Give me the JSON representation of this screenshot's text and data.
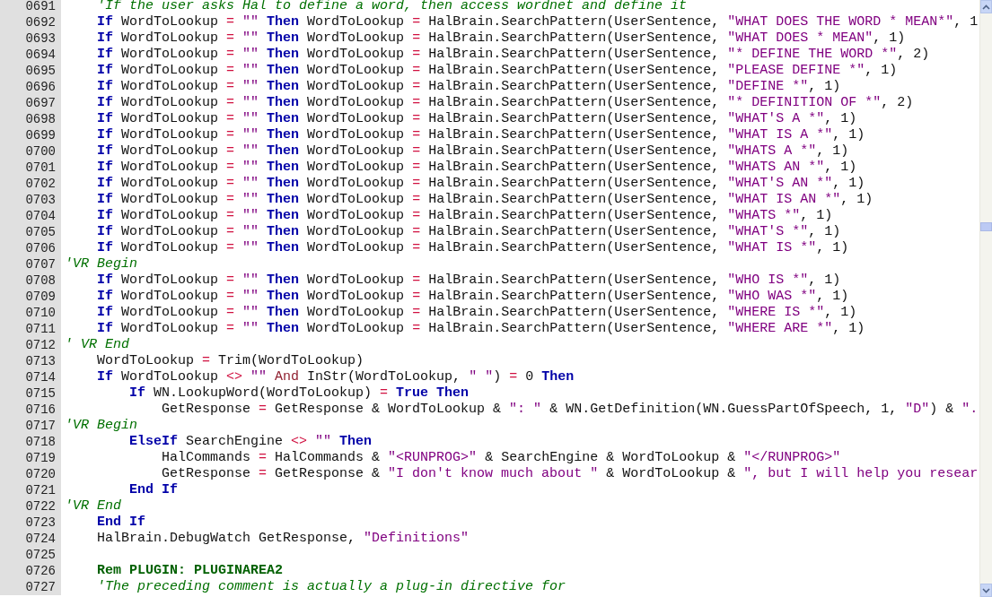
{
  "editor": {
    "lines": [
      {
        "number": "0691",
        "tokens": [
          {
            "kind": "comment",
            "text": "    'If the user asks Hal to define a word, then access wordnet and define it"
          }
        ]
      },
      {
        "number": "0692",
        "tokens": [
          {
            "kind": "keyword",
            "text": "    If"
          },
          {
            "kind": "plain",
            "text": " WordToLookup "
          },
          {
            "kind": "operator",
            "text": "= "
          },
          {
            "kind": "string",
            "text": "\"\" "
          },
          {
            "kind": "keyword",
            "text": "Then"
          },
          {
            "kind": "plain",
            "text": " WordToLookup "
          },
          {
            "kind": "operator",
            "text": "="
          },
          {
            "kind": "plain",
            "text": " HalBrain.SearchPattern(UserSentence, "
          },
          {
            "kind": "string",
            "text": "\"WHAT DOES THE WORD * MEAN*\""
          },
          {
            "kind": "plain",
            "text": ", 1"
          }
        ]
      },
      {
        "number": "0693",
        "tokens": [
          {
            "kind": "keyword",
            "text": "    If"
          },
          {
            "kind": "plain",
            "text": " WordToLookup "
          },
          {
            "kind": "operator",
            "text": "= "
          },
          {
            "kind": "string",
            "text": "\"\" "
          },
          {
            "kind": "keyword",
            "text": "Then"
          },
          {
            "kind": "plain",
            "text": " WordToLookup "
          },
          {
            "kind": "operator",
            "text": "="
          },
          {
            "kind": "plain",
            "text": " HalBrain.SearchPattern(UserSentence, "
          },
          {
            "kind": "string",
            "text": "\"WHAT DOES * MEAN\""
          },
          {
            "kind": "plain",
            "text": ", 1)"
          }
        ]
      },
      {
        "number": "0694",
        "tokens": [
          {
            "kind": "keyword",
            "text": "    If"
          },
          {
            "kind": "plain",
            "text": " WordToLookup "
          },
          {
            "kind": "operator",
            "text": "= "
          },
          {
            "kind": "string",
            "text": "\"\" "
          },
          {
            "kind": "keyword",
            "text": "Then"
          },
          {
            "kind": "plain",
            "text": " WordToLookup "
          },
          {
            "kind": "operator",
            "text": "="
          },
          {
            "kind": "plain",
            "text": " HalBrain.SearchPattern(UserSentence, "
          },
          {
            "kind": "string",
            "text": "\"* DEFINE THE WORD *\""
          },
          {
            "kind": "plain",
            "text": ", 2)"
          }
        ]
      },
      {
        "number": "0695",
        "tokens": [
          {
            "kind": "keyword",
            "text": "    If"
          },
          {
            "kind": "plain",
            "text": " WordToLookup "
          },
          {
            "kind": "operator",
            "text": "= "
          },
          {
            "kind": "string",
            "text": "\"\" "
          },
          {
            "kind": "keyword",
            "text": "Then"
          },
          {
            "kind": "plain",
            "text": " WordToLookup "
          },
          {
            "kind": "operator",
            "text": "="
          },
          {
            "kind": "plain",
            "text": " HalBrain.SearchPattern(UserSentence, "
          },
          {
            "kind": "string",
            "text": "\"PLEASE DEFINE *\""
          },
          {
            "kind": "plain",
            "text": ", 1)"
          }
        ]
      },
      {
        "number": "0696",
        "tokens": [
          {
            "kind": "keyword",
            "text": "    If"
          },
          {
            "kind": "plain",
            "text": " WordToLookup "
          },
          {
            "kind": "operator",
            "text": "= "
          },
          {
            "kind": "string",
            "text": "\"\" "
          },
          {
            "kind": "keyword",
            "text": "Then"
          },
          {
            "kind": "plain",
            "text": " WordToLookup "
          },
          {
            "kind": "operator",
            "text": "="
          },
          {
            "kind": "plain",
            "text": " HalBrain.SearchPattern(UserSentence, "
          },
          {
            "kind": "string",
            "text": "\"DEFINE *\""
          },
          {
            "kind": "plain",
            "text": ", 1)"
          }
        ]
      },
      {
        "number": "0697",
        "tokens": [
          {
            "kind": "keyword",
            "text": "    If"
          },
          {
            "kind": "plain",
            "text": " WordToLookup "
          },
          {
            "kind": "operator",
            "text": "= "
          },
          {
            "kind": "string",
            "text": "\"\" "
          },
          {
            "kind": "keyword",
            "text": "Then"
          },
          {
            "kind": "plain",
            "text": " WordToLookup "
          },
          {
            "kind": "operator",
            "text": "="
          },
          {
            "kind": "plain",
            "text": " HalBrain.SearchPattern(UserSentence, "
          },
          {
            "kind": "string",
            "text": "\"* DEFINITION OF *\""
          },
          {
            "kind": "plain",
            "text": ", 2)"
          }
        ]
      },
      {
        "number": "0698",
        "tokens": [
          {
            "kind": "keyword",
            "text": "    If"
          },
          {
            "kind": "plain",
            "text": " WordToLookup "
          },
          {
            "kind": "operator",
            "text": "= "
          },
          {
            "kind": "string",
            "text": "\"\" "
          },
          {
            "kind": "keyword",
            "text": "Then"
          },
          {
            "kind": "plain",
            "text": " WordToLookup "
          },
          {
            "kind": "operator",
            "text": "="
          },
          {
            "kind": "plain",
            "text": " HalBrain.SearchPattern(UserSentence, "
          },
          {
            "kind": "string",
            "text": "\"WHAT'S A *\""
          },
          {
            "kind": "plain",
            "text": ", 1)"
          }
        ]
      },
      {
        "number": "0699",
        "tokens": [
          {
            "kind": "keyword",
            "text": "    If"
          },
          {
            "kind": "plain",
            "text": " WordToLookup "
          },
          {
            "kind": "operator",
            "text": "= "
          },
          {
            "kind": "string",
            "text": "\"\" "
          },
          {
            "kind": "keyword",
            "text": "Then"
          },
          {
            "kind": "plain",
            "text": " WordToLookup "
          },
          {
            "kind": "operator",
            "text": "="
          },
          {
            "kind": "plain",
            "text": " HalBrain.SearchPattern(UserSentence, "
          },
          {
            "kind": "string",
            "text": "\"WHAT IS A *\""
          },
          {
            "kind": "plain",
            "text": ", 1)"
          }
        ]
      },
      {
        "number": "0700",
        "tokens": [
          {
            "kind": "keyword",
            "text": "    If"
          },
          {
            "kind": "plain",
            "text": " WordToLookup "
          },
          {
            "kind": "operator",
            "text": "= "
          },
          {
            "kind": "string",
            "text": "\"\" "
          },
          {
            "kind": "keyword",
            "text": "Then"
          },
          {
            "kind": "plain",
            "text": " WordToLookup "
          },
          {
            "kind": "operator",
            "text": "="
          },
          {
            "kind": "plain",
            "text": " HalBrain.SearchPattern(UserSentence, "
          },
          {
            "kind": "string",
            "text": "\"WHATS A *\""
          },
          {
            "kind": "plain",
            "text": ", 1)"
          }
        ]
      },
      {
        "number": "0701",
        "tokens": [
          {
            "kind": "keyword",
            "text": "    If"
          },
          {
            "kind": "plain",
            "text": " WordToLookup "
          },
          {
            "kind": "operator",
            "text": "= "
          },
          {
            "kind": "string",
            "text": "\"\" "
          },
          {
            "kind": "keyword",
            "text": "Then"
          },
          {
            "kind": "plain",
            "text": " WordToLookup "
          },
          {
            "kind": "operator",
            "text": "="
          },
          {
            "kind": "plain",
            "text": " HalBrain.SearchPattern(UserSentence, "
          },
          {
            "kind": "string",
            "text": "\"WHATS AN *\""
          },
          {
            "kind": "plain",
            "text": ", 1)"
          }
        ]
      },
      {
        "number": "0702",
        "tokens": [
          {
            "kind": "keyword",
            "text": "    If"
          },
          {
            "kind": "plain",
            "text": " WordToLookup "
          },
          {
            "kind": "operator",
            "text": "= "
          },
          {
            "kind": "string",
            "text": "\"\" "
          },
          {
            "kind": "keyword",
            "text": "Then"
          },
          {
            "kind": "plain",
            "text": " WordToLookup "
          },
          {
            "kind": "operator",
            "text": "="
          },
          {
            "kind": "plain",
            "text": " HalBrain.SearchPattern(UserSentence, "
          },
          {
            "kind": "string",
            "text": "\"WHAT'S AN *\""
          },
          {
            "kind": "plain",
            "text": ", 1)"
          }
        ]
      },
      {
        "number": "0703",
        "tokens": [
          {
            "kind": "keyword",
            "text": "    If"
          },
          {
            "kind": "plain",
            "text": " WordToLookup "
          },
          {
            "kind": "operator",
            "text": "= "
          },
          {
            "kind": "string",
            "text": "\"\" "
          },
          {
            "kind": "keyword",
            "text": "Then"
          },
          {
            "kind": "plain",
            "text": " WordToLookup "
          },
          {
            "kind": "operator",
            "text": "="
          },
          {
            "kind": "plain",
            "text": " HalBrain.SearchPattern(UserSentence, "
          },
          {
            "kind": "string",
            "text": "\"WHAT IS AN *\""
          },
          {
            "kind": "plain",
            "text": ", 1)"
          }
        ]
      },
      {
        "number": "0704",
        "tokens": [
          {
            "kind": "keyword",
            "text": "    If"
          },
          {
            "kind": "plain",
            "text": " WordToLookup "
          },
          {
            "kind": "operator",
            "text": "= "
          },
          {
            "kind": "string",
            "text": "\"\" "
          },
          {
            "kind": "keyword",
            "text": "Then"
          },
          {
            "kind": "plain",
            "text": " WordToLookup "
          },
          {
            "kind": "operator",
            "text": "="
          },
          {
            "kind": "plain",
            "text": " HalBrain.SearchPattern(UserSentence, "
          },
          {
            "kind": "string",
            "text": "\"WHATS *\""
          },
          {
            "kind": "plain",
            "text": ", 1)"
          }
        ]
      },
      {
        "number": "0705",
        "tokens": [
          {
            "kind": "keyword",
            "text": "    If"
          },
          {
            "kind": "plain",
            "text": " WordToLookup "
          },
          {
            "kind": "operator",
            "text": "= "
          },
          {
            "kind": "string",
            "text": "\"\" "
          },
          {
            "kind": "keyword",
            "text": "Then"
          },
          {
            "kind": "plain",
            "text": " WordToLookup "
          },
          {
            "kind": "operator",
            "text": "="
          },
          {
            "kind": "plain",
            "text": " HalBrain.SearchPattern(UserSentence, "
          },
          {
            "kind": "string",
            "text": "\"WHAT'S *\""
          },
          {
            "kind": "plain",
            "text": ", 1)"
          }
        ]
      },
      {
        "number": "0706",
        "tokens": [
          {
            "kind": "keyword",
            "text": "    If"
          },
          {
            "kind": "plain",
            "text": " WordToLookup "
          },
          {
            "kind": "operator",
            "text": "= "
          },
          {
            "kind": "string",
            "text": "\"\" "
          },
          {
            "kind": "keyword",
            "text": "Then"
          },
          {
            "kind": "plain",
            "text": " WordToLookup "
          },
          {
            "kind": "operator",
            "text": "="
          },
          {
            "kind": "plain",
            "text": " HalBrain.SearchPattern(UserSentence, "
          },
          {
            "kind": "string",
            "text": "\"WHAT IS *\""
          },
          {
            "kind": "plain",
            "text": ", 1)"
          }
        ]
      },
      {
        "number": "0707",
        "tokens": [
          {
            "kind": "comment",
            "text": "'VR Begin"
          }
        ]
      },
      {
        "number": "0708",
        "tokens": [
          {
            "kind": "keyword",
            "text": "    If"
          },
          {
            "kind": "plain",
            "text": " WordToLookup "
          },
          {
            "kind": "operator",
            "text": "= "
          },
          {
            "kind": "string",
            "text": "\"\" "
          },
          {
            "kind": "keyword",
            "text": "Then"
          },
          {
            "kind": "plain",
            "text": " WordToLookup "
          },
          {
            "kind": "operator",
            "text": "="
          },
          {
            "kind": "plain",
            "text": " HalBrain.SearchPattern(UserSentence, "
          },
          {
            "kind": "string",
            "text": "\"WHO IS *\""
          },
          {
            "kind": "plain",
            "text": ", 1)"
          }
        ]
      },
      {
        "number": "0709",
        "tokens": [
          {
            "kind": "keyword",
            "text": "    If"
          },
          {
            "kind": "plain",
            "text": " WordToLookup "
          },
          {
            "kind": "operator",
            "text": "= "
          },
          {
            "kind": "string",
            "text": "\"\" "
          },
          {
            "kind": "keyword",
            "text": "Then"
          },
          {
            "kind": "plain",
            "text": " WordToLookup "
          },
          {
            "kind": "operator",
            "text": "="
          },
          {
            "kind": "plain",
            "text": " HalBrain.SearchPattern(UserSentence, "
          },
          {
            "kind": "string",
            "text": "\"WHO WAS *\""
          },
          {
            "kind": "plain",
            "text": ", 1)"
          }
        ]
      },
      {
        "number": "0710",
        "tokens": [
          {
            "kind": "keyword",
            "text": "    If"
          },
          {
            "kind": "plain",
            "text": " WordToLookup "
          },
          {
            "kind": "operator",
            "text": "= "
          },
          {
            "kind": "string",
            "text": "\"\" "
          },
          {
            "kind": "keyword",
            "text": "Then"
          },
          {
            "kind": "plain",
            "text": " WordToLookup "
          },
          {
            "kind": "operator",
            "text": "="
          },
          {
            "kind": "plain",
            "text": " HalBrain.SearchPattern(UserSentence, "
          },
          {
            "kind": "string",
            "text": "\"WHERE IS *\""
          },
          {
            "kind": "plain",
            "text": ", 1)"
          }
        ]
      },
      {
        "number": "0711",
        "tokens": [
          {
            "kind": "keyword",
            "text": "    If"
          },
          {
            "kind": "plain",
            "text": " WordToLookup "
          },
          {
            "kind": "operator",
            "text": "= "
          },
          {
            "kind": "string",
            "text": "\"\" "
          },
          {
            "kind": "keyword",
            "text": "Then"
          },
          {
            "kind": "plain",
            "text": " WordToLookup "
          },
          {
            "kind": "operator",
            "text": "="
          },
          {
            "kind": "plain",
            "text": " HalBrain.SearchPattern(UserSentence, "
          },
          {
            "kind": "string",
            "text": "\"WHERE ARE *\""
          },
          {
            "kind": "plain",
            "text": ", 1)"
          }
        ]
      },
      {
        "number": "0712",
        "tokens": [
          {
            "kind": "comment",
            "text": "' VR End"
          }
        ]
      },
      {
        "number": "0713",
        "tokens": [
          {
            "kind": "plain",
            "text": "    WordToLookup "
          },
          {
            "kind": "operator",
            "text": "="
          },
          {
            "kind": "plain",
            "text": " Trim(WordToLookup)"
          }
        ]
      },
      {
        "number": "0714",
        "tokens": [
          {
            "kind": "keyword",
            "text": "    If"
          },
          {
            "kind": "plain",
            "text": " WordToLookup "
          },
          {
            "kind": "operator",
            "text": "<> "
          },
          {
            "kind": "string",
            "text": "\"\" "
          },
          {
            "kind": "logic",
            "text": "And"
          },
          {
            "kind": "plain",
            "text": " InStr(WordToLookup, "
          },
          {
            "kind": "string",
            "text": "\" \""
          },
          {
            "kind": "plain",
            "text": ") "
          },
          {
            "kind": "operator",
            "text": "="
          },
          {
            "kind": "plain",
            "text": " 0 "
          },
          {
            "kind": "keyword",
            "text": "Then"
          }
        ]
      },
      {
        "number": "0715",
        "tokens": [
          {
            "kind": "keyword",
            "text": "        If"
          },
          {
            "kind": "plain",
            "text": " WN.LookupWord(WordToLookup) "
          },
          {
            "kind": "operator",
            "text": "= "
          },
          {
            "kind": "keyword",
            "text": "True Then"
          }
        ]
      },
      {
        "number": "0716",
        "tokens": [
          {
            "kind": "plain",
            "text": "            GetResponse "
          },
          {
            "kind": "operator",
            "text": "="
          },
          {
            "kind": "plain",
            "text": " GetResponse & WordToLookup & "
          },
          {
            "kind": "string",
            "text": "\": \""
          },
          {
            "kind": "plain",
            "text": " & WN.GetDefinition(WN.GuessPartOfSpeech, 1, "
          },
          {
            "kind": "string",
            "text": "\"D\""
          },
          {
            "kind": "plain",
            "text": ") & "
          },
          {
            "kind": "string",
            "text": "\"."
          }
        ]
      },
      {
        "number": "0717",
        "tokens": [
          {
            "kind": "comment",
            "text": "'VR Begin"
          }
        ]
      },
      {
        "number": "0718",
        "tokens": [
          {
            "kind": "keyword",
            "text": "        ElseIf"
          },
          {
            "kind": "plain",
            "text": " SearchEngine "
          },
          {
            "kind": "operator",
            "text": "<> "
          },
          {
            "kind": "string",
            "text": "\"\" "
          },
          {
            "kind": "keyword",
            "text": "Then"
          }
        ]
      },
      {
        "number": "0719",
        "tokens": [
          {
            "kind": "plain",
            "text": "            HalCommands "
          },
          {
            "kind": "operator",
            "text": "="
          },
          {
            "kind": "plain",
            "text": " HalCommands & "
          },
          {
            "kind": "string",
            "text": "\"<RUNPROG>\""
          },
          {
            "kind": "plain",
            "text": " & SearchEngine & WordToLookup & "
          },
          {
            "kind": "string",
            "text": "\"</RUNPROG>\""
          }
        ]
      },
      {
        "number": "0720",
        "tokens": [
          {
            "kind": "plain",
            "text": "            GetResponse "
          },
          {
            "kind": "operator",
            "text": "="
          },
          {
            "kind": "plain",
            "text": " GetResponse & "
          },
          {
            "kind": "string",
            "text": "\"I don't know much about \""
          },
          {
            "kind": "plain",
            "text": " & WordToLookup & "
          },
          {
            "kind": "string",
            "text": "\", but I will help you resear"
          }
        ]
      },
      {
        "number": "0721",
        "tokens": [
          {
            "kind": "keyword",
            "text": "        End If"
          }
        ]
      },
      {
        "number": "0722",
        "tokens": [
          {
            "kind": "comment",
            "text": "'VR End"
          }
        ]
      },
      {
        "number": "0723",
        "tokens": [
          {
            "kind": "keyword",
            "text": "    End If"
          }
        ]
      },
      {
        "number": "0724",
        "tokens": [
          {
            "kind": "plain",
            "text": "    HalBrain.DebugWatch GetResponse, "
          },
          {
            "kind": "string",
            "text": "\"Definitions\""
          }
        ]
      },
      {
        "number": "0725"
      },
      {
        "number": "0726",
        "tokens": [
          {
            "kind": "directive",
            "text": "    Rem PLUGIN: PLUGINAREA2"
          }
        ]
      },
      {
        "number": "0727",
        "tokens": [
          {
            "kind": "comment",
            "text": "    'The preceding comment is actually a plug-in directive for"
          }
        ]
      }
    ]
  }
}
